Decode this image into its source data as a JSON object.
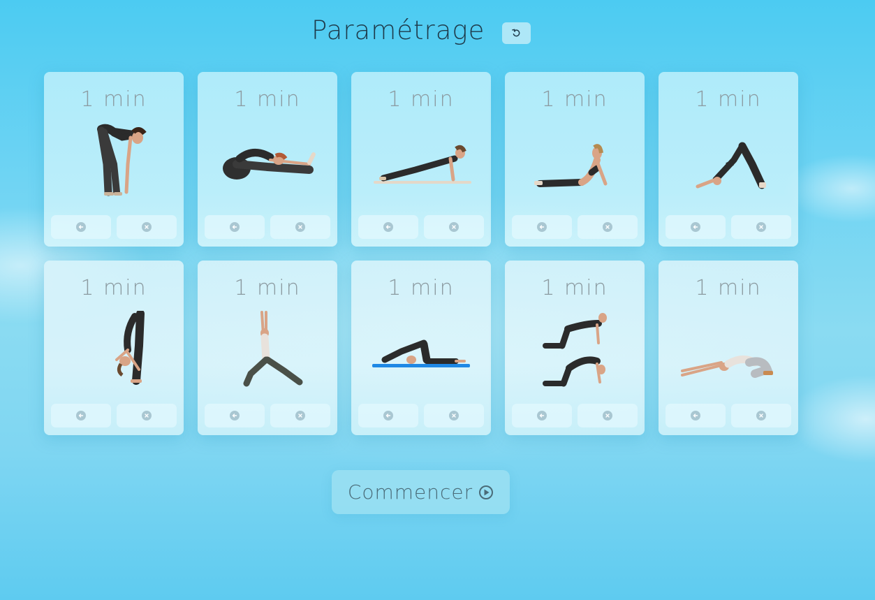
{
  "header": {
    "title": "Paramétrage",
    "reset_icon": "undo-icon"
  },
  "cards": [
    {
      "duration": "1 min",
      "pose": "standing-forward-bend"
    },
    {
      "duration": "1 min",
      "pose": "seated-forward-bend"
    },
    {
      "duration": "1 min",
      "pose": "plank"
    },
    {
      "duration": "1 min",
      "pose": "cobra"
    },
    {
      "duration": "1 min",
      "pose": "downward-dog"
    },
    {
      "duration": "1 min",
      "pose": "deep-forward-fold"
    },
    {
      "duration": "1 min",
      "pose": "crescent-lunge"
    },
    {
      "duration": "1 min",
      "pose": "plow"
    },
    {
      "duration": "1 min",
      "pose": "cat-cow"
    },
    {
      "duration": "1 min",
      "pose": "child-pose"
    }
  ],
  "card_buttons": {
    "left_icon": "arrow-left-circle-icon",
    "right_icon": "close-circle-icon"
  },
  "start": {
    "label": "Commencer",
    "icon": "play-circle-icon"
  },
  "colors": {
    "title": "#1e3a4a",
    "duration_text": "#8b9aa0",
    "button_icon": "#a9c7d2",
    "start_text": "#4a6b78"
  }
}
